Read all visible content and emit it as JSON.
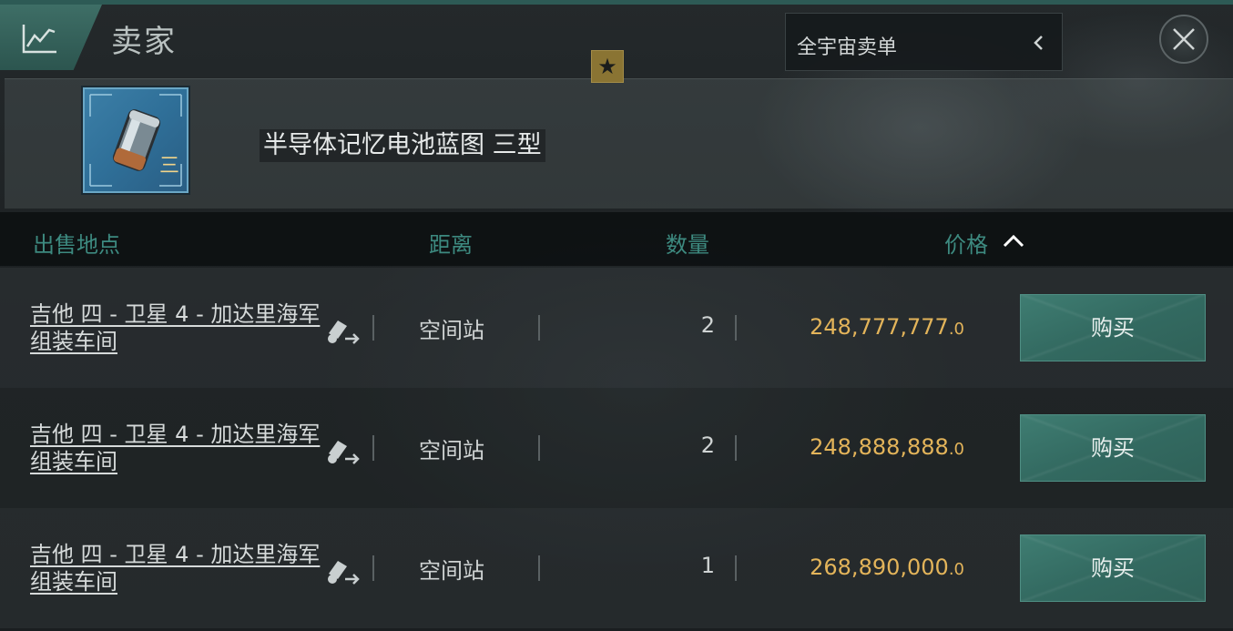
{
  "header": {
    "title": "卖家",
    "scope_dropdown": {
      "selected": "全宇宙卖单"
    }
  },
  "item": {
    "name": "半导体记忆电池蓝图 三型",
    "tier_badge": "三",
    "favorite_glyph": "★"
  },
  "table": {
    "columns": {
      "location": "出售地点",
      "distance": "距离",
      "quantity": "数量",
      "price": "价格"
    },
    "sort": {
      "column": "price",
      "direction": "ascending"
    },
    "rows": [
      {
        "location": "吉他 四 - 卫星 4 - 加达里海军 组装车间",
        "distance": "空间站",
        "quantity": "2",
        "price": "248,777,777",
        "price_decimal": ".0",
        "buy_label": "购买"
      },
      {
        "location": "吉他 四 - 卫星 4 - 加达里海军 组装车间",
        "distance": "空间站",
        "quantity": "2",
        "price": "248,888,888",
        "price_decimal": ".0",
        "buy_label": "购买"
      },
      {
        "location": "吉他 四 - 卫星 4 - 加达里海军 组装车间",
        "distance": "空间站",
        "quantity": "1",
        "price": "268,890,000",
        "price_decimal": ".0",
        "buy_label": "购买"
      }
    ]
  },
  "colors": {
    "accent": "#3d8a80",
    "price": "#e3b45a",
    "buy_button": "#336a61",
    "star_badge": "#8a7433"
  },
  "icons": {
    "market_chart": "chart-icon",
    "dropdown_toggle": "chevron-left-icon",
    "close": "close-icon",
    "sort": "chevron-up-icon",
    "route": "route-icon"
  }
}
